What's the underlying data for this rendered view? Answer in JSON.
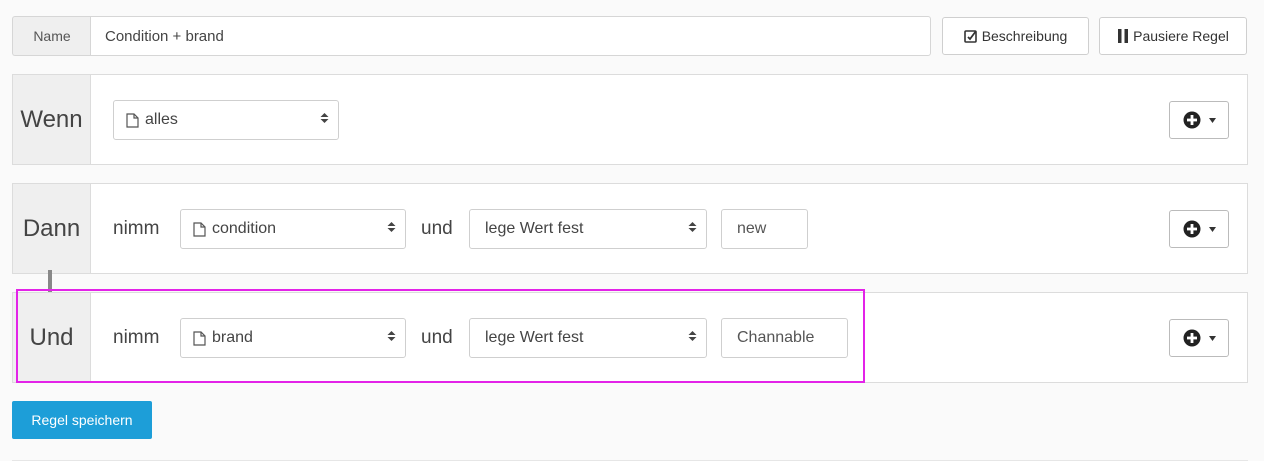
{
  "name_row": {
    "label": "Name",
    "value": "Condition + brand",
    "description_button": "Beschreibung",
    "pause_button": "Pausiere Regel"
  },
  "wenn_row": {
    "label": "Wenn",
    "select_value": "alles"
  },
  "dann_row": {
    "label": "Dann",
    "take_word": "nimm",
    "field_select": "condition",
    "and_word": "und",
    "action_select": "lege Wert fest",
    "value": "new"
  },
  "und_row": {
    "label": "Und",
    "take_word": "nimm",
    "field_select": "brand",
    "and_word": "und",
    "action_select": "lege Wert fest",
    "value": "Channable"
  },
  "save_button": "Regel speichern",
  "colors": {
    "primary": "#1d9ed8",
    "highlight": "#e323e8",
    "label_bg": "#efefef"
  },
  "icons": {
    "description": "edit-square-icon",
    "pause": "pause-icon",
    "document": "document-icon",
    "sort": "sort-caret-icon",
    "add": "plus-circle-icon",
    "dropdown": "caret-down-icon"
  }
}
